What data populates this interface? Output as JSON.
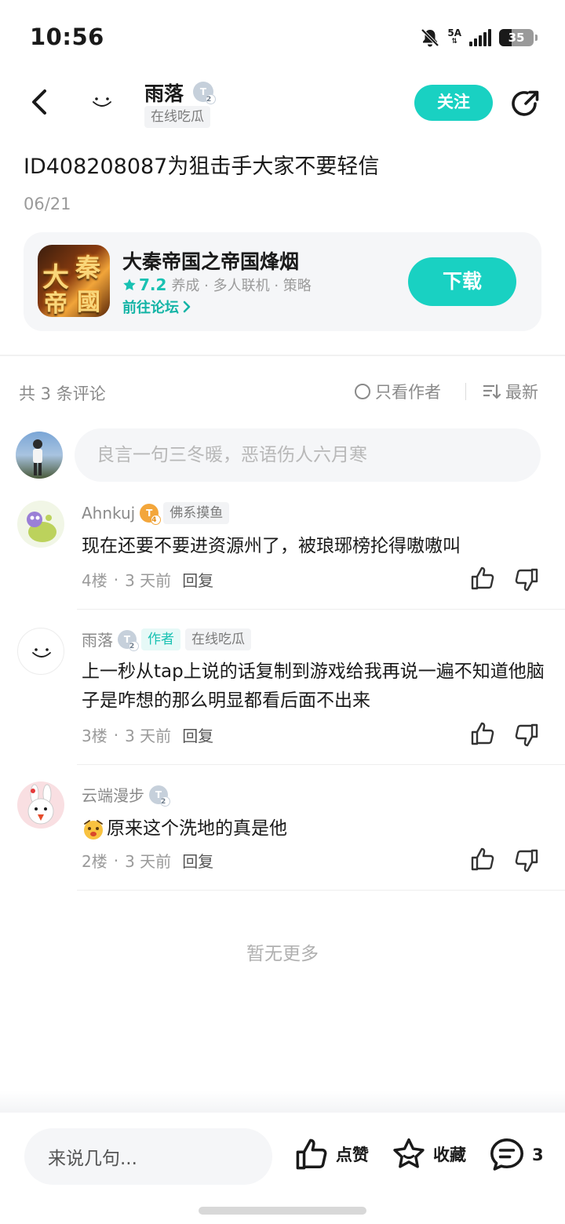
{
  "status_bar": {
    "time": "10:56",
    "network": "5A",
    "battery": "35"
  },
  "header": {
    "author_name": "雨落",
    "author_level": "2",
    "author_tag": "在线吃瓜",
    "follow_label": "关注"
  },
  "post": {
    "title": "ID408208087为狙击手大家不要轻信",
    "date": "06/21"
  },
  "game_card": {
    "name": "大秦帝国之帝国烽烟",
    "rating": "7.2",
    "genres": "养成 · 多人联机 · 策略",
    "forum_link": "前往论坛",
    "download_label": "下载",
    "icon_text": [
      "大",
      "秦",
      "帝",
      "國"
    ]
  },
  "comments_header": {
    "count_label": "共 3 条评论",
    "only_author_label": "只看作者",
    "sort_label": "最新"
  },
  "composer": {
    "placeholder": "良言一句三冬暖，恶语伤人六月寒"
  },
  "comments": [
    {
      "name": "Ahnkuj",
      "level": "4",
      "tag": "佛系摸鱼",
      "text": "现在还要不要进资源州了，被琅琊榜抡得嗷嗷叫",
      "floor": "4楼",
      "time": "3 天前",
      "reply": "回复"
    },
    {
      "name": "雨落",
      "level": "2",
      "author_badge": "作者",
      "tag": "在线吃瓜",
      "text": "上一秒从tap上说的话复制到游戏给我再说一遍不知道他脑子是咋想的那么明显都看后面不出来",
      "floor": "3楼",
      "time": "3 天前",
      "reply": "回复"
    },
    {
      "name": "云端漫步",
      "level": "2",
      "text": "原来这个洗地的真是他",
      "floor": "2楼",
      "time": "3 天前",
      "reply": "回复"
    }
  ],
  "no_more": "暂无更多",
  "bottom_bar": {
    "input_placeholder": "来说几句...",
    "like_label": "点赞",
    "favorite_label": "收藏",
    "comment_count": "3"
  },
  "colors": {
    "accent": "#19d1c2",
    "text": "#1a1a1a",
    "muted": "#9a9a9a"
  }
}
